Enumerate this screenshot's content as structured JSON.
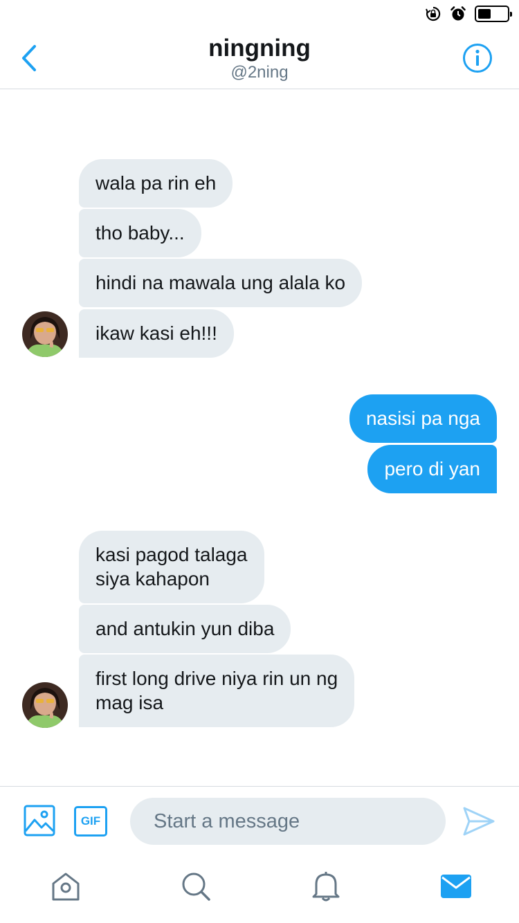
{
  "colors": {
    "accent": "#1da1f2",
    "incoming_bubble": "#e6ecf0",
    "secondary_text": "#657786",
    "icon_gray": "#657786"
  },
  "status_bar": {
    "icons": [
      "orientation-lock-icon",
      "alarm-icon",
      "battery-icon"
    ],
    "battery_level": 0.45
  },
  "header": {
    "title": "ningning",
    "handle": "@2ning",
    "back_icon": "chevron-left-icon",
    "info_icon": "info-icon"
  },
  "messages": [
    {
      "side": "incoming",
      "text": "wala pa rin eh"
    },
    {
      "side": "incoming",
      "text": "tho baby..."
    },
    {
      "side": "incoming",
      "text": "hindi na mawala ung alala ko"
    },
    {
      "side": "incoming",
      "text": "ikaw kasi eh!!!",
      "avatar": true
    },
    {
      "side": "outgoing",
      "text": "nasisi pa nga"
    },
    {
      "side": "outgoing",
      "text": "pero di yan"
    },
    {
      "side": "incoming",
      "text": "kasi pagod talaga\nsiya kahapon"
    },
    {
      "side": "incoming",
      "text": "and antukin yun diba"
    },
    {
      "side": "incoming",
      "text": "first long drive niya rin un ng\nmag isa",
      "avatar": true
    }
  ],
  "composer": {
    "image_icon": "image-icon",
    "gif_label": "GIF",
    "placeholder": "Start a message",
    "send_icon": "send-icon"
  },
  "tab_bar": {
    "tabs": [
      {
        "name": "home-icon",
        "active": false
      },
      {
        "name": "search-icon",
        "active": false
      },
      {
        "name": "notifications-icon",
        "active": false
      },
      {
        "name": "messages-icon",
        "active": true
      }
    ]
  }
}
